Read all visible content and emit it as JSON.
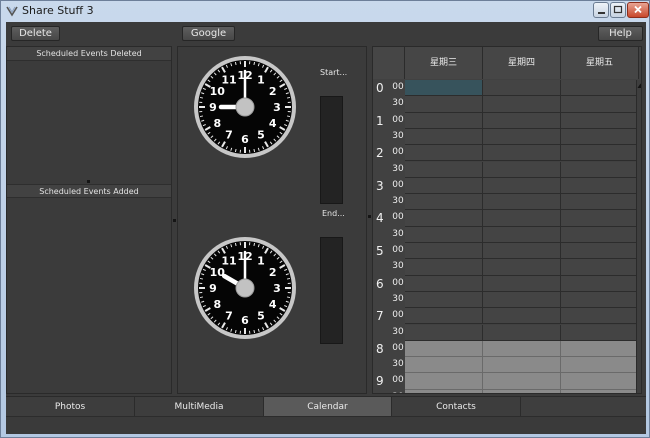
{
  "window": {
    "title": "Share Stuff 3"
  },
  "toolbar": {
    "delete_label": "Delete",
    "google_label": "Google",
    "help_label": "Help"
  },
  "panels": {
    "deleted_header": "Scheduled Events Deleted",
    "added_header": "Scheduled Events  Added"
  },
  "clocks": {
    "start_label": "Start...",
    "end_label": "End...",
    "start_time": {
      "hour": 9,
      "minute": 0
    },
    "end_time": {
      "hour": 10,
      "minute": 0
    },
    "numerals": [
      "12",
      "1",
      "2",
      "3",
      "4",
      "5",
      "6",
      "7",
      "8",
      "9",
      "10",
      "11"
    ]
  },
  "calendar": {
    "days": [
      "星期三",
      "星期四",
      "星期五"
    ],
    "hours": [
      "0",
      "1",
      "2",
      "3",
      "4",
      "5",
      "6",
      "7",
      "8",
      "9"
    ],
    "minutes": [
      "00",
      "30"
    ]
  },
  "tabs": [
    "Photos",
    "MultiMedia",
    "Calendar",
    "Contacts"
  ],
  "active_tab": "Calendar",
  "colors": {
    "background": "#3b3b3b",
    "selected_cell": "#37535c",
    "shaded_rows": "#8a8a8a"
  }
}
